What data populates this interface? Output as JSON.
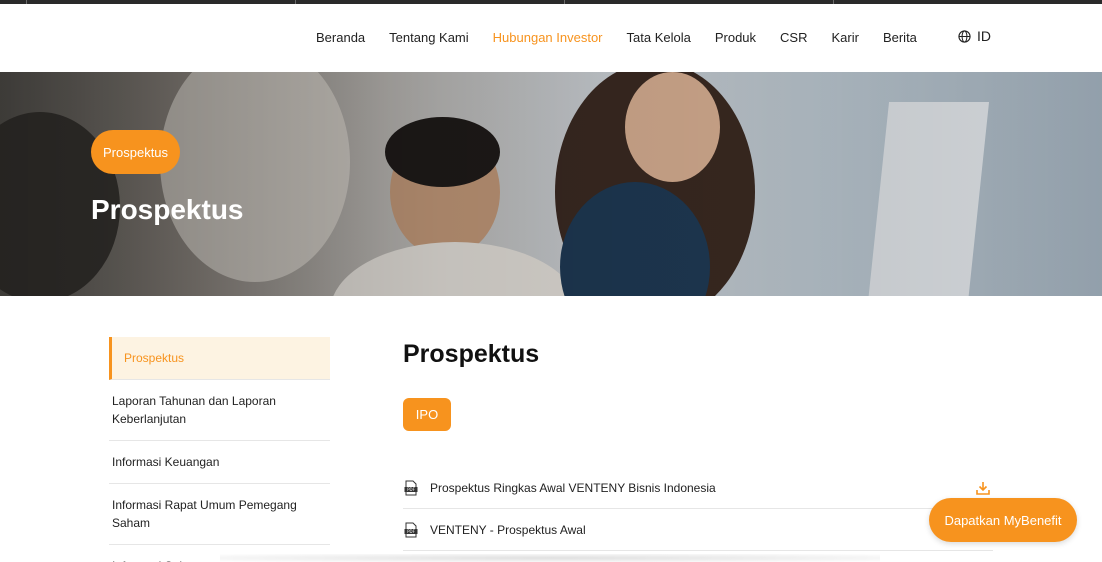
{
  "nav": {
    "items": [
      {
        "label": "Beranda",
        "active": false
      },
      {
        "label": "Tentang Kami",
        "active": false
      },
      {
        "label": "Hubungan Investor",
        "active": true
      },
      {
        "label": "Tata Kelola",
        "active": false
      },
      {
        "label": "Produk",
        "active": false
      },
      {
        "label": "CSR",
        "active": false
      },
      {
        "label": "Karir",
        "active": false
      },
      {
        "label": "Berita",
        "active": false
      }
    ],
    "language": "ID",
    "language_icon": "globe-icon"
  },
  "hero": {
    "badge": "Prospektus",
    "title": "Prospektus"
  },
  "sidebar": {
    "items": [
      {
        "label": "Prospektus",
        "active": true
      },
      {
        "label": "Laporan Tahunan dan Laporan Keberlanjutan",
        "active": false
      },
      {
        "label": "Informasi Keuangan",
        "active": false
      },
      {
        "label": "Informasi Rapat Umum Pemegang Saham",
        "active": false
      },
      {
        "label": "Informasi Saham",
        "active": false
      }
    ]
  },
  "main": {
    "title": "Prospektus",
    "tab": "IPO",
    "documents": [
      {
        "label": "Prospektus Ringkas Awal VENTENY Bisnis Indonesia",
        "icon": "pdf-icon",
        "action_icon": "download-icon"
      },
      {
        "label": "VENTENY - Prospektus Awal",
        "icon": "pdf-icon",
        "action_icon": "download-icon"
      }
    ]
  },
  "cta": {
    "label": "Dapatkan MyBenefit"
  },
  "colors": {
    "accent": "#f7931e",
    "active_bg": "#fdf3e2"
  }
}
